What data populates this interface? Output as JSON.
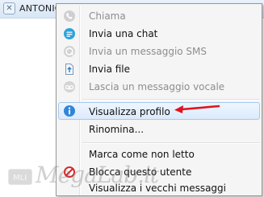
{
  "contact": {
    "name": "ANTONIO"
  },
  "menu": {
    "items": [
      {
        "label": "Chiama",
        "enabled": false,
        "icon": "phone-icon"
      },
      {
        "label": "Invia una chat",
        "enabled": true,
        "icon": "chat-icon"
      },
      {
        "label": "Invia un messaggio SMS",
        "enabled": false,
        "icon": "sms-icon"
      },
      {
        "label": "Invia file",
        "enabled": true,
        "icon": "file-icon"
      },
      {
        "label": "Lascia un messaggio vocale",
        "enabled": false,
        "icon": "voicemail-icon"
      },
      {
        "label": "Visualizza profilo",
        "enabled": true,
        "icon": "info-icon",
        "highlighted": true
      },
      {
        "label": "Rinomina...",
        "enabled": true
      },
      {
        "label": "Marca come non letto",
        "enabled": true
      },
      {
        "label": "Blocca questo utente",
        "enabled": true
      },
      {
        "label": "Visualizza i vecchi messaggi",
        "enabled": true
      }
    ]
  },
  "colors": {
    "highlight": "#dbeafc",
    "arrow": "#e0141e"
  },
  "watermark": {
    "text": "MegaLab.it"
  }
}
